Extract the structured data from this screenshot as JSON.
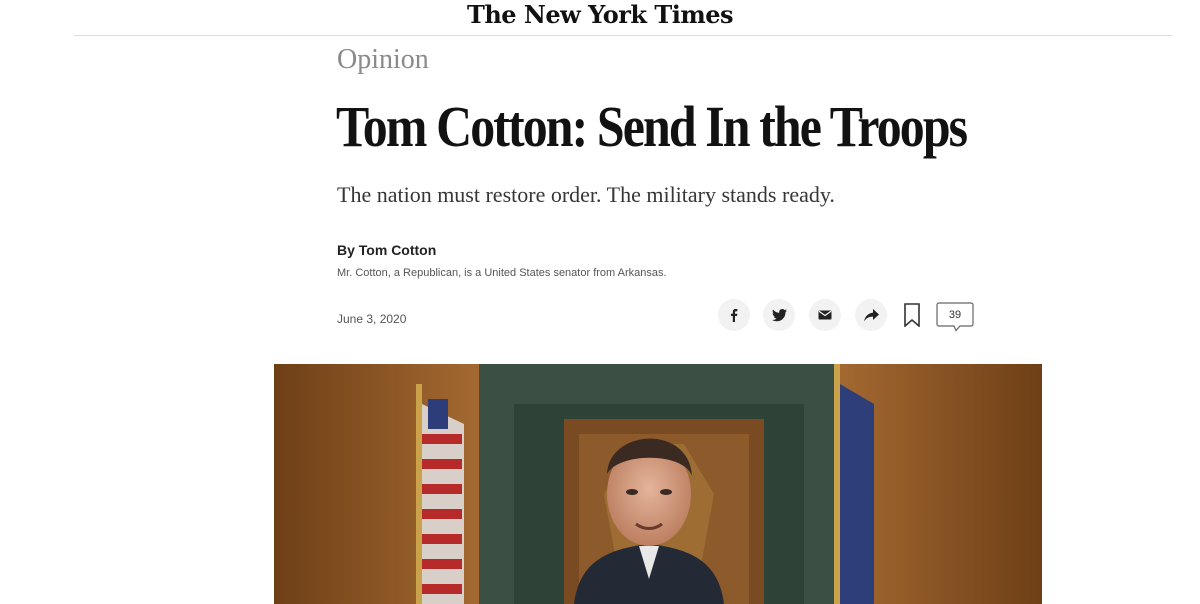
{
  "masthead": {
    "logo_text": "The New York Times"
  },
  "article": {
    "kicker": "Opinion",
    "headline": "Tom Cotton: Send In the Troops",
    "summary": "The nation must restore order. The military stands ready.",
    "byline": "By Tom Cotton",
    "author_bio": "Mr. Cotton, a Republican, is a United States senator from Arkansas.",
    "date": "June 3, 2020"
  },
  "share_tools": {
    "facebook": "facebook-icon",
    "twitter": "twitter-icon",
    "email": "email-icon",
    "share": "share-icon",
    "save": "bookmark-icon",
    "comments_count": "39"
  },
  "lead_photo": {
    "subject": "photo"
  },
  "colors": {
    "kicker": "#8a8a8a",
    "headline": "#121212",
    "summary": "#363636",
    "share_bg": "#f2f2f2"
  }
}
